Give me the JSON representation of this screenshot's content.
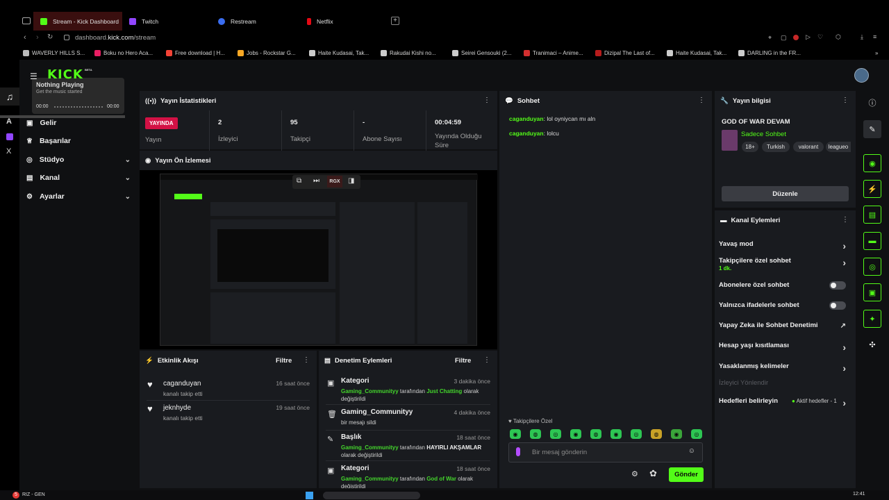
{
  "browser": {
    "tabs": [
      {
        "label": "Stream - Kick Dashboard",
        "color": "#53fc18",
        "active": true
      },
      {
        "label": "Twitch",
        "color": "#9146ff"
      },
      {
        "label": "Restream",
        "color": "#3a6df0"
      },
      {
        "label": "Netflix",
        "color": "#e50914"
      }
    ],
    "url_host": "dashboard.",
    "url_domain": "kick.com",
    "url_path": "/stream",
    "bookmarks": [
      {
        "label": "WAVERLY HILLS S..."
      },
      {
        "label": "Boku no Hero Aca..."
      },
      {
        "label": "Free download | H..."
      },
      {
        "label": "Jobs - Rockstar G..."
      },
      {
        "label": "Haite Kudasai, Tak..."
      },
      {
        "label": "Rakudai Kishi no..."
      },
      {
        "label": "Seirei Gensouki (2..."
      },
      {
        "label": "Tranimaci – Anime..."
      },
      {
        "label": "Dizipal The Last of..."
      },
      {
        "label": "Haite Kudasai, Tak..."
      },
      {
        "label": "DARLING in the FR..."
      }
    ]
  },
  "brand": {
    "logo": "KICK",
    "beta": "BETA",
    "accent": "#53fc18"
  },
  "music": {
    "title": "Nothing Playing",
    "subtitle": "Get the music started",
    "time_start": "00:00",
    "time_end": "00:00"
  },
  "nav": {
    "items": [
      {
        "label": "Gelir"
      },
      {
        "label": "Başarılar"
      },
      {
        "label": "Stüdyo"
      },
      {
        "label": "Kanal"
      },
      {
        "label": "Ayarlar"
      }
    ]
  },
  "stats": {
    "title": "Yayın İstatistikleri",
    "live_badge": "YAYINDA",
    "live_label": "Yayın",
    "items": [
      {
        "value": "2",
        "label": "İzleyici"
      },
      {
        "value": "95",
        "label": "Takipçi"
      },
      {
        "value": "-",
        "label": "Abone Sayısı"
      },
      {
        "value": "00:04:59",
        "label": "Yayında Olduğu Süre"
      }
    ]
  },
  "preview": {
    "title": "Yayın Ön İzlemesi",
    "control_rgx": "RGX"
  },
  "activity": {
    "title": "Etkinlik Akışı",
    "filter": "Filtre",
    "items": [
      {
        "user": "caganduyan",
        "action": "kanalı takip etti",
        "time": "16 saat önce"
      },
      {
        "user": "jeknhyde",
        "action": "kanalı takip etti",
        "time": "19 saat önce"
      }
    ]
  },
  "moderation": {
    "title": "Denetim Eylemleri",
    "filter": "Filtre",
    "items": [
      {
        "title": "Kategori",
        "time": "3 dakika önce",
        "actor": "Gaming_Communityy",
        "middle": "tarafından",
        "target": "Just Chatting",
        "tail": "olarak değiştirildi"
      },
      {
        "title": "Gaming_Communityy",
        "time": "4 dakika önce",
        "text": "bir mesajı sildi"
      },
      {
        "title": "Başlık",
        "time": "18 saat önce",
        "actor": "Gaming_Communityy",
        "middle": "tarafından",
        "target": "HAYIRLI AKŞAMLAR",
        "tail": "olarak değiştirildi"
      },
      {
        "title": "Kategori",
        "time": "18 saat önce",
        "actor": "Gaming_Communityy",
        "middle": "tarafından",
        "target": "God of War",
        "tail": "olarak değiştirildi"
      }
    ]
  },
  "chat": {
    "title": "Sohbet",
    "messages": [
      {
        "user": "caganduyan",
        "text": ": lol oyniycan mı aln"
      },
      {
        "user": "caganduyan",
        "text": ": lolcu"
      }
    ],
    "mode_label": "Takipçilere Özel",
    "placeholder": "Bir mesaj gönderin",
    "send": "Gönder"
  },
  "stream_info": {
    "title": "Yayın bilgisi",
    "stream_title": "GOD OF WAR DEVAM",
    "category": "Sadece Sohbet",
    "tags": [
      "18+",
      "Turkish",
      "valorant",
      "leagueo"
    ],
    "edit": "Düzenle"
  },
  "channel_actions": {
    "title": "Kanal Eylemleri",
    "items": [
      {
        "label": "Yavaş mod",
        "control": "arrow"
      },
      {
        "label": "Takipçilere özel sohbet",
        "sub": "1 dk.",
        "control": "arrow"
      },
      {
        "label": "Abonelere özel sohbet",
        "control": "toggle"
      },
      {
        "label": "Yalnızca ifadelerle sohbet",
        "control": "toggle"
      },
      {
        "label": "Yapay Zeka ile Sohbet Denetimi",
        "control": "external"
      },
      {
        "label": "Hesap yaşı kısıtlaması",
        "control": "arrow"
      },
      {
        "label": "Yasaklanmış kelimeler",
        "control": "arrow"
      },
      {
        "label": "İzleyici Yönlendir",
        "control": "disabled"
      },
      {
        "label": "Hedefleri belirleyin",
        "extra": "Aktif hedefler - 1",
        "control": "arrow"
      }
    ]
  },
  "taskbar": {
    "left_label": "RIZ - GEN",
    "badge": "5",
    "time": "12:41"
  }
}
